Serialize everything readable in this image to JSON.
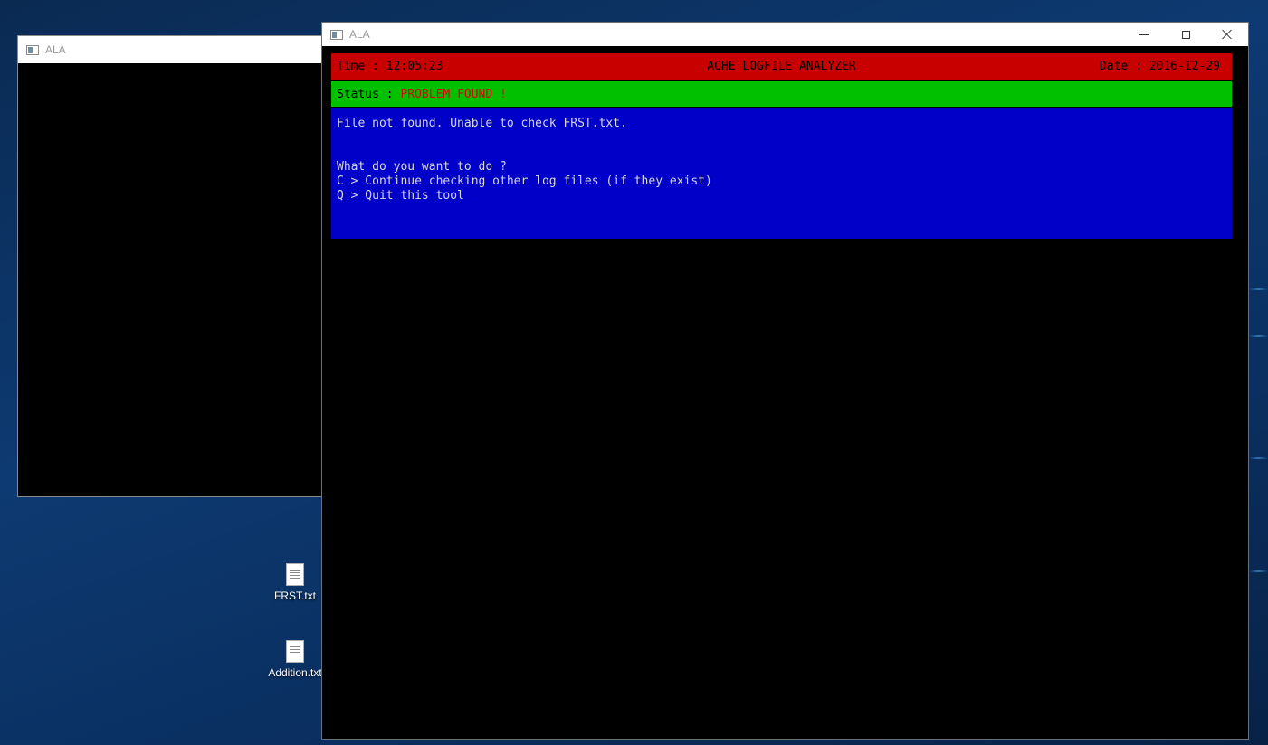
{
  "desktop": {
    "icons": [
      {
        "label": "FRST.txt",
        "icon": "text-file-icon"
      },
      {
        "label": "Addition.txt",
        "icon": "text-file-icon"
      }
    ]
  },
  "back_window": {
    "title": "ALA"
  },
  "front_window": {
    "title": "ALA",
    "controls": {
      "minimize": "minimize-icon",
      "maximize": "maximize-icon",
      "close": "close-icon"
    }
  },
  "console": {
    "header": {
      "time": "Time : 12:05:23",
      "app_title": "ACHE LOGFILE ANALYZER",
      "date": "Date : 2016-12-29",
      "background": "#c80000"
    },
    "status": {
      "label": "Status : ",
      "value": "PROBLEM FOUND !",
      "background": "#00c000",
      "value_color": "#e00000"
    },
    "panel": {
      "background": "#0000c8",
      "message": "File not found. Unable to check FRST.txt.",
      "question": "What do you want to do ?",
      "options": [
        "C > Continue checking other log files (if they exist)",
        "Q > Quit this tool"
      ]
    }
  }
}
